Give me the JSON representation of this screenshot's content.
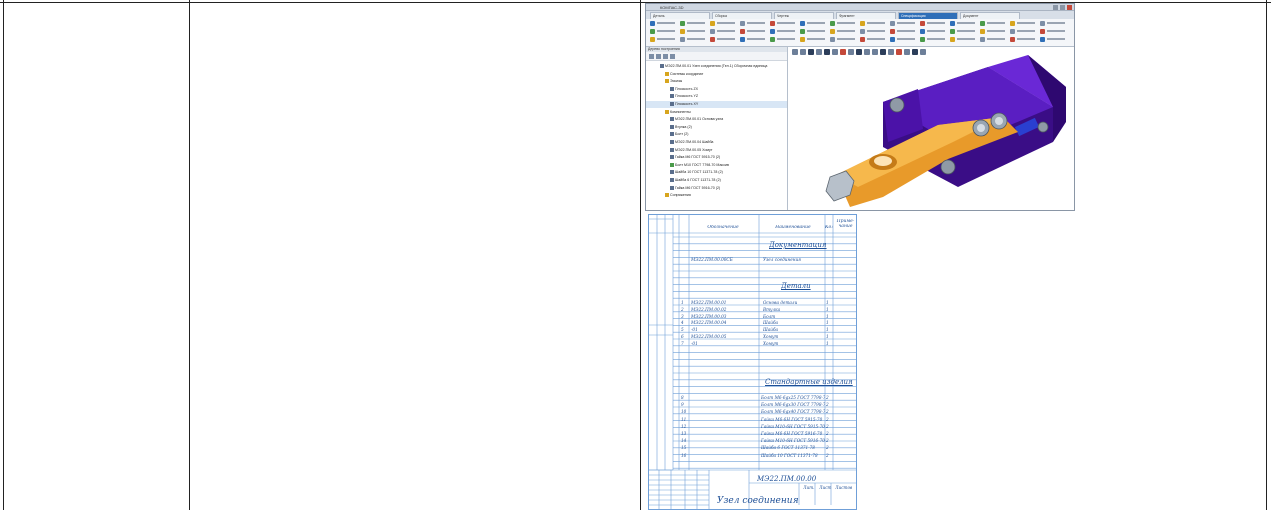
{
  "cad_window": {
    "title": "КОМПАС-3D",
    "tabs": [
      "Деталь",
      "Сборка",
      "Чертеж",
      "Фрагмент",
      "Спецификация",
      "Документ"
    ],
    "active_tab_index": 4,
    "tree_header": "Дерево построения",
    "tree": [
      {
        "label": "МЭ22.ПМ.00.01 Узел соединения (Тел.1) Сборочная единица",
        "icon": "assembly",
        "indent": 0
      },
      {
        "label": "Системы координат",
        "icon": "folder",
        "indent": 1
      },
      {
        "label": "Эскизы",
        "icon": "folder",
        "indent": 1
      },
      {
        "label": "Плоскость ZX",
        "icon": "plane",
        "indent": 2
      },
      {
        "label": "Плоскость YZ",
        "icon": "plane",
        "indent": 2
      },
      {
        "label": "Плоскость XY",
        "icon": "plane",
        "indent": 2,
        "selected": true
      },
      {
        "label": "Компоненты",
        "icon": "folder",
        "indent": 1
      },
      {
        "label": "МЭ22.ПМ.00.01 Основа узла",
        "icon": "part",
        "indent": 2
      },
      {
        "label": "Втулка (2)",
        "icon": "part",
        "indent": 2
      },
      {
        "label": "Болт (2)",
        "icon": "part",
        "indent": 2
      },
      {
        "label": "МЭ22.ПМ.00.04 Шайба",
        "icon": "part",
        "indent": 2
      },
      {
        "label": "МЭ22.ПМ.00.05 Хомут",
        "icon": "part",
        "indent": 2
      },
      {
        "label": "Гайка М6 ГОСТ 5915-70 (2)",
        "icon": "part",
        "indent": 2
      },
      {
        "label": "Болт М10 ГОСТ 7798-70 Массив",
        "icon": "part-green",
        "indent": 2
      },
      {
        "label": "Шайба 10 ГОСТ 11371-78 (2)",
        "icon": "part",
        "indent": 2
      },
      {
        "label": "Шайба 6 ГОСТ 11371-78 (2)",
        "icon": "part",
        "indent": 2
      },
      {
        "label": "Гайка М6 ГОСТ 5916-70 (2)",
        "icon": "part",
        "indent": 2
      },
      {
        "label": "Сопряжения",
        "icon": "folder",
        "indent": 1
      }
    ]
  },
  "spec_sheet": {
    "columns": [
      "Обозначение",
      "Наименование",
      "Кол.",
      "Приме-чание"
    ],
    "sections": {
      "documentation": "Документация",
      "parts": "Детали",
      "standard": "Стандартные изделия"
    },
    "doc_rows": [
      {
        "designation": "МЭ22.ПМ.00.00СБ",
        "name": "Узел соединения",
        "qty": ""
      }
    ],
    "part_rows": [
      {
        "pos": "1",
        "designation": "МЭ22.ПМ.00.01",
        "name": "Основа детали",
        "qty": "1"
      },
      {
        "pos": "2",
        "designation": "МЭ22.ПМ.00.02",
        "name": "Втулка",
        "qty": "1"
      },
      {
        "pos": "3",
        "designation": "МЭ22.ПМ.00.03",
        "name": "Болт",
        "qty": "1"
      },
      {
        "pos": "4",
        "designation": "МЭ22.ПМ.00.04",
        "name": "Шайба",
        "qty": "1"
      },
      {
        "pos": "5",
        "designation": "-01",
        "name": "Шайба",
        "qty": "1"
      },
      {
        "pos": "6",
        "designation": "МЭ22.ПМ.00.05",
        "name": "Хомут",
        "qty": "1"
      },
      {
        "pos": "7",
        "designation": "-01",
        "name": "Хомут",
        "qty": "1"
      }
    ],
    "std_rows": [
      {
        "pos": "8",
        "name": "Болт М6-6gx25 ГОСТ 7798-70",
        "qty": "2"
      },
      {
        "pos": "9",
        "name": "Болт М6-6gx30 ГОСТ 7798-70",
        "qty": "2"
      },
      {
        "pos": "10",
        "name": "Болт М6-6gx40 ГОСТ 7798-70",
        "qty": "2"
      },
      {
        "pos": "11",
        "name": "Гайка М6-6Н ГОСТ 5915-70",
        "qty": "2"
      },
      {
        "pos": "12",
        "name": "Гайка М10-6Н ГОСТ 5915-70",
        "qty": "2"
      },
      {
        "pos": "13",
        "name": "Гайка М6-6Н ГОСТ 5916-70",
        "qty": "2"
      },
      {
        "pos": "14",
        "name": "Гайка М10-6Н ГОСТ 5916-70",
        "qty": "2"
      },
      {
        "pos": "15",
        "name": "Шайба 6 ГОСТ 11371-78",
        "qty": "2"
      },
      {
        "pos": "16",
        "name": "Шайба 10 ГОСТ 11371-78",
        "qty": "2"
      }
    ],
    "stamp_designation": "МЭ22.ПМ.00.00",
    "stamp_title": "Узел соединения",
    "stamp_cols": [
      "Лит.",
      "Лист",
      "Листов"
    ]
  },
  "colors": {
    "spec_line": "#6f9fd8",
    "spec_text": "#1e4f96",
    "model_purple": "#4b12a8",
    "model_orange": "#f2aa3c",
    "model_steel": "#9aa6b2"
  }
}
